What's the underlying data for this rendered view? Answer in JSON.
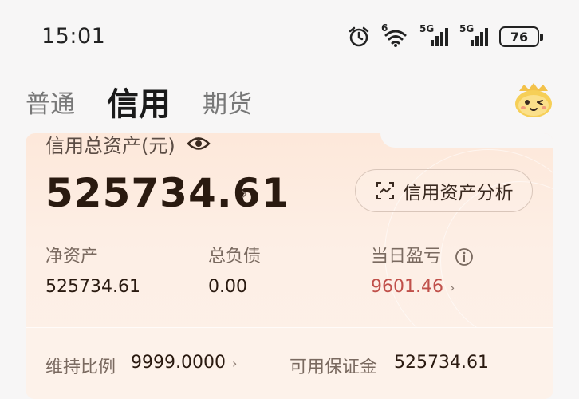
{
  "status_bar": {
    "time": "15:01",
    "battery_level": "76",
    "wifi_label": "6",
    "sim1_label": "5G",
    "sim2_label": "5G"
  },
  "tabs": [
    {
      "label": "普通",
      "active": false
    },
    {
      "label": "信用",
      "active": true
    },
    {
      "label": "期货",
      "active": false
    }
  ],
  "card": {
    "asset_label": "信用总资产(元)",
    "total_assets": "525734.61",
    "analyze_button_label": "信用资产分析",
    "metrics": {
      "net_assets_label": "净资产",
      "net_assets_value": "525734.61",
      "total_liabilities_label": "总负债",
      "total_liabilities_value": "0.00",
      "daily_pnl_label": "当日盈亏",
      "daily_pnl_value": "9601.46"
    },
    "footer": {
      "maintenance_ratio_label": "维持比例",
      "maintenance_ratio_value": "9999.0000",
      "available_margin_label": "可用保证金",
      "available_margin_value": "525734.61"
    }
  },
  "colors": {
    "positive": "#c0504a",
    "card_bg": "#fde8da"
  }
}
